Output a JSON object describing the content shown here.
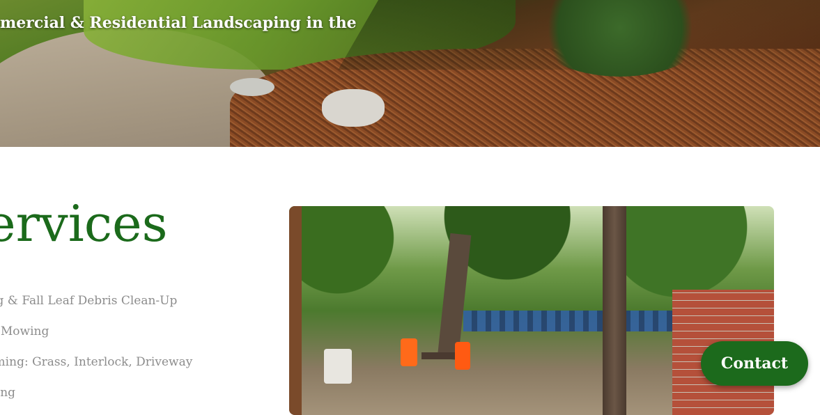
{
  "hero": {
    "text": "mercial & Residential Landscaping in the"
  },
  "services": {
    "title": "ervices",
    "items": [
      "ring & Fall Leaf Debris Clean-Up",
      "wn Mowing",
      "imming: Grass, Interlock, Driveway",
      "owing"
    ]
  },
  "contact_button": {
    "label": "Contact"
  },
  "colors": {
    "brand_green": "#1c6a1c",
    "list_gray": "#8c8c8c"
  }
}
